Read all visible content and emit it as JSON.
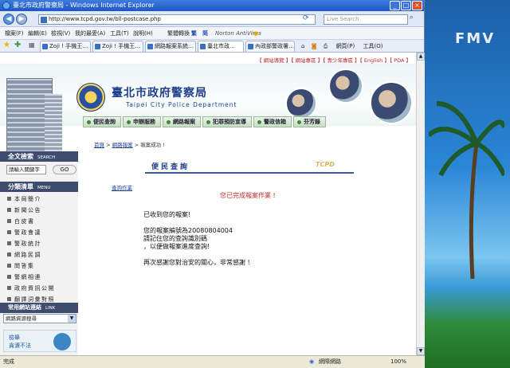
{
  "window": {
    "title": "臺北市政府警察局 - Windows Internet Explorer"
  },
  "address": {
    "url": "http://www.tcpd.gov.tw/bll-postcase.php",
    "search_placeholder": "Live Search"
  },
  "menu": {
    "items": [
      "檔案(F)",
      "編輯(E)",
      "檢視(V)",
      "我的最愛(A)",
      "工具(T)",
      "說明(H)"
    ],
    "translate": "繁體轉換",
    "trad": "繁",
    "simp": "简",
    "norton": "Norton AntiVirus"
  },
  "tabs": [
    "Zoji ! 手機王…",
    "Zoji ! 手機王…",
    "網路報案系統…",
    "臺北市政…",
    "內政部警政署…"
  ],
  "tools": {
    "page": "網頁(P)",
    "tools": "工具(O)"
  },
  "site": {
    "toplinks": "【 網站導覽 】【 網站專區 】【 青少年專區 】【 English 】【 PDA 】",
    "title_zh": "臺北市政府警察局",
    "title_en": "Taipei City Police Department",
    "nav": [
      "便民查詢",
      "申辦服務",
      "網路報案",
      "犯罪預防宣導",
      "警政信箱",
      "芬芳錄"
    ]
  },
  "sidebar": {
    "search_title": "全文檢索",
    "search_en": "SEARCH",
    "keyword": "請輸入關鍵字",
    "go": "GO",
    "menu_title": "分類清單",
    "menu_en": "MENU",
    "items": [
      "本局簡介",
      "新聞公告",
      "白皮書",
      "警政會議",
      "警政統計",
      "網路民調",
      "問答集",
      "警網相連",
      "政府資訊公開",
      "翻譯詞彙對照"
    ],
    "links_title": "常用網站連結",
    "links_en": "LINK",
    "select_value": "網路資源搜尋",
    "card_line1": "檢舉",
    "card_line2": "貪瀆不法"
  },
  "content": {
    "breadcrumb_home": "首頁",
    "breadcrumb_sep1": " > ",
    "breadcrumb_mid": "網路報案",
    "breadcrumb_sep2": " > ",
    "breadcrumb_end": "報案成功 !",
    "section_title": "便民查詢",
    "section_tag": "TCPD",
    "left_link": "查詢作業",
    "done_msg": "您已完成報案作業 !",
    "lines": [
      "已收到您的報案!",
      "您的報案編號為20080804004",
      "請記住您的查詢識別碼",
      "，以便做報案進度查詢!",
      "再次感謝您對治安的關心，非常感謝 !"
    ]
  },
  "status": {
    "left": "完成",
    "zone": "網際網路",
    "zoom": "100%"
  },
  "desktop": {
    "label": "FMV"
  }
}
